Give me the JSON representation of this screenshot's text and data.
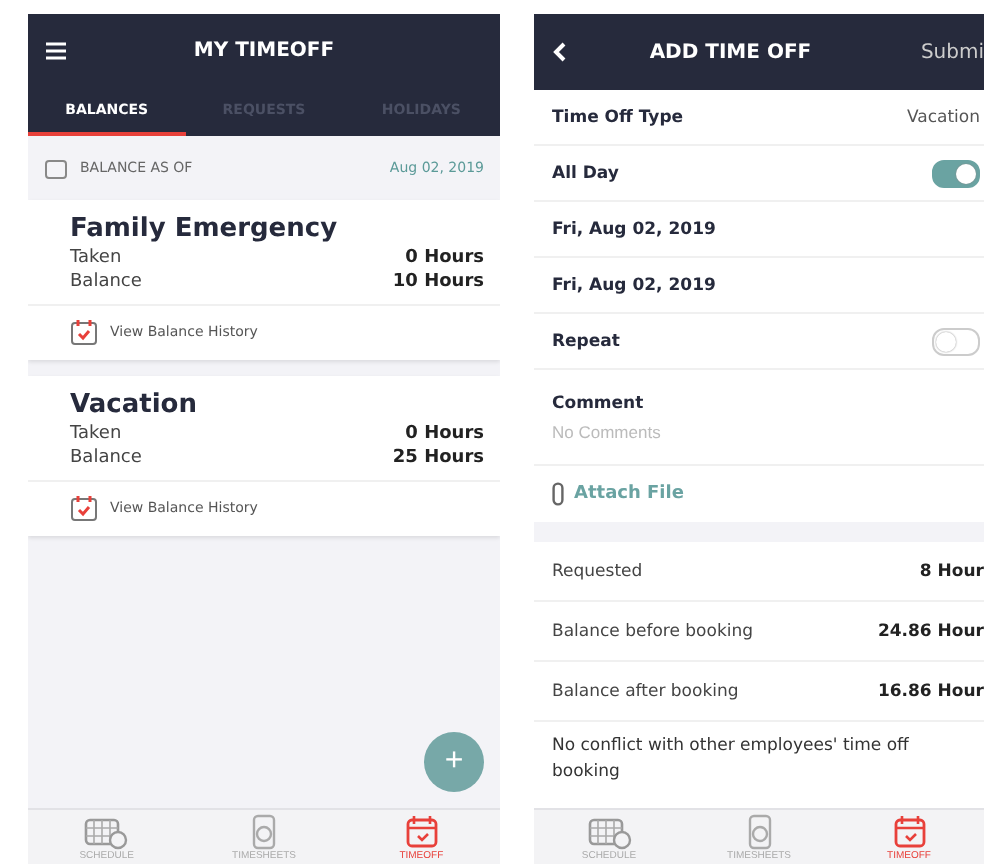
{
  "balances_screen": {
    "header": {
      "title": "MY TIMEOFF"
    },
    "tabs": [
      {
        "label": "BALANCES",
        "selected": true
      },
      {
        "label": "REQUESTS",
        "selected": false
      },
      {
        "label": "HOLIDAYS",
        "selected": false
      }
    ],
    "balance_as_of": {
      "label": "BALANCE AS OF",
      "date": "Aug 02, 2019"
    },
    "cards": [
      {
        "name": "Family Emergency",
        "rows": [
          {
            "label": "Taken",
            "value": "0 Hours"
          },
          {
            "label": "Balance",
            "value": "10 Hours"
          }
        ],
        "link": "View Balance History"
      },
      {
        "name": "Vacation",
        "rows": [
          {
            "label": "Taken",
            "value": "0 Hours"
          },
          {
            "label": "Balance",
            "value": "25 Hours"
          }
        ],
        "link": "View Balance History"
      }
    ],
    "fab": "+",
    "bottom_nav": [
      {
        "label": "SCHEDULE",
        "selected": false
      },
      {
        "label": "TIMESHEETS",
        "selected": false
      },
      {
        "label": "TIMEOFF",
        "selected": true
      }
    ]
  },
  "add_time_off_screen": {
    "header": {
      "title": "ADD TIME OFF",
      "action": "Submi"
    },
    "fields": [
      {
        "kind": "value",
        "label": "Time Off Type",
        "value": "Vacation"
      },
      {
        "kind": "toggle",
        "label": "All Day",
        "on": true
      },
      {
        "kind": "date",
        "label": "Fri, Aug 02, 2019"
      },
      {
        "kind": "date",
        "label": "Fri, Aug 02, 2019"
      },
      {
        "kind": "toggle",
        "label": "Repeat",
        "on": false
      },
      {
        "kind": "comment",
        "label": "Comment",
        "placeholder": "No Comments"
      },
      {
        "kind": "attach",
        "label": "Attach File"
      }
    ],
    "summary": [
      {
        "label": "Requested",
        "value": "8 Hour"
      },
      {
        "label": "Balance before booking",
        "value": "24.86 Hour"
      },
      {
        "label": "Balance after booking",
        "value": "16.86 Hour"
      }
    ],
    "note": "No conflict with other employees' time off booking",
    "bottom_nav": [
      {
        "label": "SCHEDULE",
        "selected": false
      },
      {
        "label": "TIMESHEETS",
        "selected": false
      },
      {
        "label": "TIMEOFF",
        "selected": true
      }
    ]
  }
}
